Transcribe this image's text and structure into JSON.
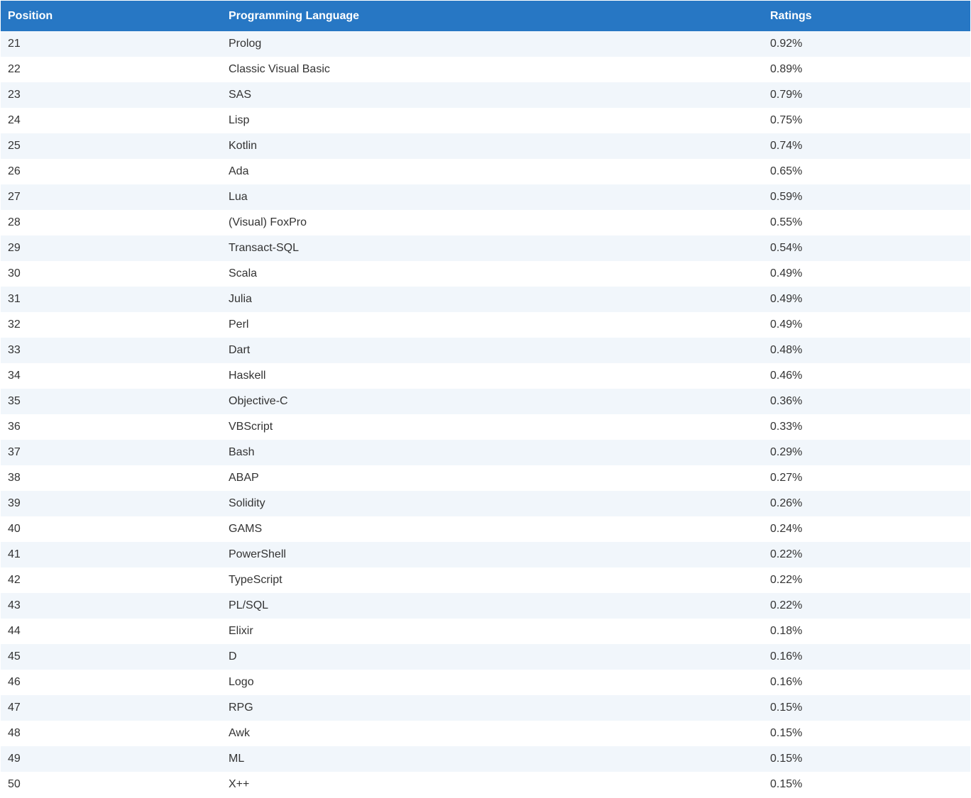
{
  "table": {
    "headers": {
      "position": "Position",
      "language": "Programming Language",
      "ratings": "Ratings"
    },
    "rows": [
      {
        "position": "21",
        "language": "Prolog",
        "rating": "0.92%"
      },
      {
        "position": "22",
        "language": "Classic Visual Basic",
        "rating": "0.89%"
      },
      {
        "position": "23",
        "language": "SAS",
        "rating": "0.79%"
      },
      {
        "position": "24",
        "language": "Lisp",
        "rating": "0.75%"
      },
      {
        "position": "25",
        "language": "Kotlin",
        "rating": "0.74%"
      },
      {
        "position": "26",
        "language": "Ada",
        "rating": "0.65%"
      },
      {
        "position": "27",
        "language": "Lua",
        "rating": "0.59%"
      },
      {
        "position": "28",
        "language": "(Visual) FoxPro",
        "rating": "0.55%"
      },
      {
        "position": "29",
        "language": "Transact-SQL",
        "rating": "0.54%"
      },
      {
        "position": "30",
        "language": "Scala",
        "rating": "0.49%"
      },
      {
        "position": "31",
        "language": "Julia",
        "rating": "0.49%"
      },
      {
        "position": "32",
        "language": "Perl",
        "rating": "0.49%"
      },
      {
        "position": "33",
        "language": "Dart",
        "rating": "0.48%"
      },
      {
        "position": "34",
        "language": "Haskell",
        "rating": "0.46%"
      },
      {
        "position": "35",
        "language": "Objective-C",
        "rating": "0.36%"
      },
      {
        "position": "36",
        "language": "VBScript",
        "rating": "0.33%"
      },
      {
        "position": "37",
        "language": "Bash",
        "rating": "0.29%"
      },
      {
        "position": "38",
        "language": "ABAP",
        "rating": "0.27%"
      },
      {
        "position": "39",
        "language": "Solidity",
        "rating": "0.26%"
      },
      {
        "position": "40",
        "language": "GAMS",
        "rating": "0.24%"
      },
      {
        "position": "41",
        "language": "PowerShell",
        "rating": "0.22%"
      },
      {
        "position": "42",
        "language": "TypeScript",
        "rating": "0.22%"
      },
      {
        "position": "43",
        "language": "PL/SQL",
        "rating": "0.22%"
      },
      {
        "position": "44",
        "language": "Elixir",
        "rating": "0.18%"
      },
      {
        "position": "45",
        "language": "D",
        "rating": "0.16%"
      },
      {
        "position": "46",
        "language": "Logo",
        "rating": "0.16%"
      },
      {
        "position": "47",
        "language": "RPG",
        "rating": "0.15%"
      },
      {
        "position": "48",
        "language": "Awk",
        "rating": "0.15%"
      },
      {
        "position": "49",
        "language": "ML",
        "rating": "0.15%"
      },
      {
        "position": "50",
        "language": "X++",
        "rating": "0.15%"
      }
    ]
  },
  "colors": {
    "header_background": "#2777c4",
    "header_text": "#ffffff",
    "row_alt_background": "#f1f6fb",
    "row_background": "#ffffff",
    "body_text": "#333333"
  }
}
